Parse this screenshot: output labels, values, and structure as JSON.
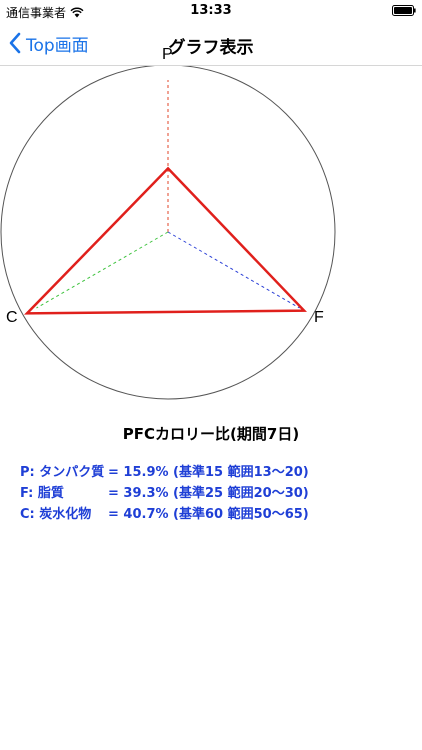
{
  "status_bar": {
    "carrier": "通信事業者",
    "time": "13:33"
  },
  "nav": {
    "back_label": "Top画面",
    "title": "グラフ表示"
  },
  "chart_data": {
    "type": "radar",
    "axes": [
      "P",
      "F",
      "C"
    ],
    "values": [
      15.9,
      39.3,
      40.7
    ],
    "reference_circle": 33.3,
    "rmax": 50,
    "title": "PFCカロリー比(期間7日)",
    "colors": {
      "P_axis": "#e0442a",
      "F_axis": "#2a3fd6",
      "C_axis": "#3cc23c",
      "polygon": "#e0201c",
      "circle": "#555555"
    }
  },
  "summary": {
    "rows": [
      {
        "key": "P: タンパク質",
        "text": "= 15.9% (基準15 範囲13〜20)"
      },
      {
        "key": "F: 脂質",
        "text": "= 39.3% (基準25 範囲20〜30)"
      },
      {
        "key": "C: 炭水化物",
        "text": "= 40.7% (基準60 範囲50〜65)"
      }
    ]
  }
}
